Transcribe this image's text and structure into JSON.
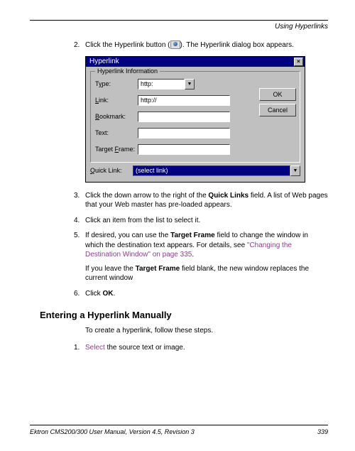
{
  "header": {
    "section": "Using Hyperlinks"
  },
  "steps": {
    "s2": {
      "num": "2.",
      "t1": "Click the Hyperlink button (",
      "t2": "). The Hyperlink dialog box appears."
    },
    "s3": {
      "num": "3.",
      "t1": "Click the down arrow to the right of the ",
      "bold": "Quick Links",
      "t2": " field. A list of Web pages that your Web master has pre-loaded appears."
    },
    "s4": {
      "num": "4.",
      "text": "Click an item from the list to select it."
    },
    "s5": {
      "num": "5.",
      "t1": "If desired, you can use the ",
      "bold1": "Target Frame",
      "t2": " field to change the window in which the destination text appears. For details, see ",
      "link": "\"Changing the Destination Window\" on page 335",
      "t3": ".",
      "p2a": "If you leave the ",
      "p2bold": "Target Frame",
      "p2b": " field blank, the new window replaces the current window"
    },
    "s6": {
      "num": "6.",
      "t1": "Click ",
      "bold": "OK",
      "t2": "."
    }
  },
  "dialog": {
    "title": "Hyperlink",
    "group": "Hyperlink Information",
    "labels": {
      "type": "Type:",
      "link": "Link:",
      "bookmark": "Bookmark:",
      "text": "Text:",
      "target": "Target Frame:",
      "quick": "Quick Link:"
    },
    "values": {
      "type": "http:",
      "link": "http://",
      "quick": "(select link)"
    },
    "buttons": {
      "ok": "OK",
      "cancel": "Cancel"
    },
    "close": "×",
    "arrow": "▼"
  },
  "section2": {
    "heading": "Entering a Hyperlink Manually",
    "intro": "To create a hyperlink, follow these steps.",
    "step1": {
      "num": "1.",
      "sel": "Select",
      "rest": " the source text or image."
    }
  },
  "footer": {
    "left": "Ektron CMS200/300 User Manual, Version 4.5, Revision 3",
    "right": "339"
  }
}
